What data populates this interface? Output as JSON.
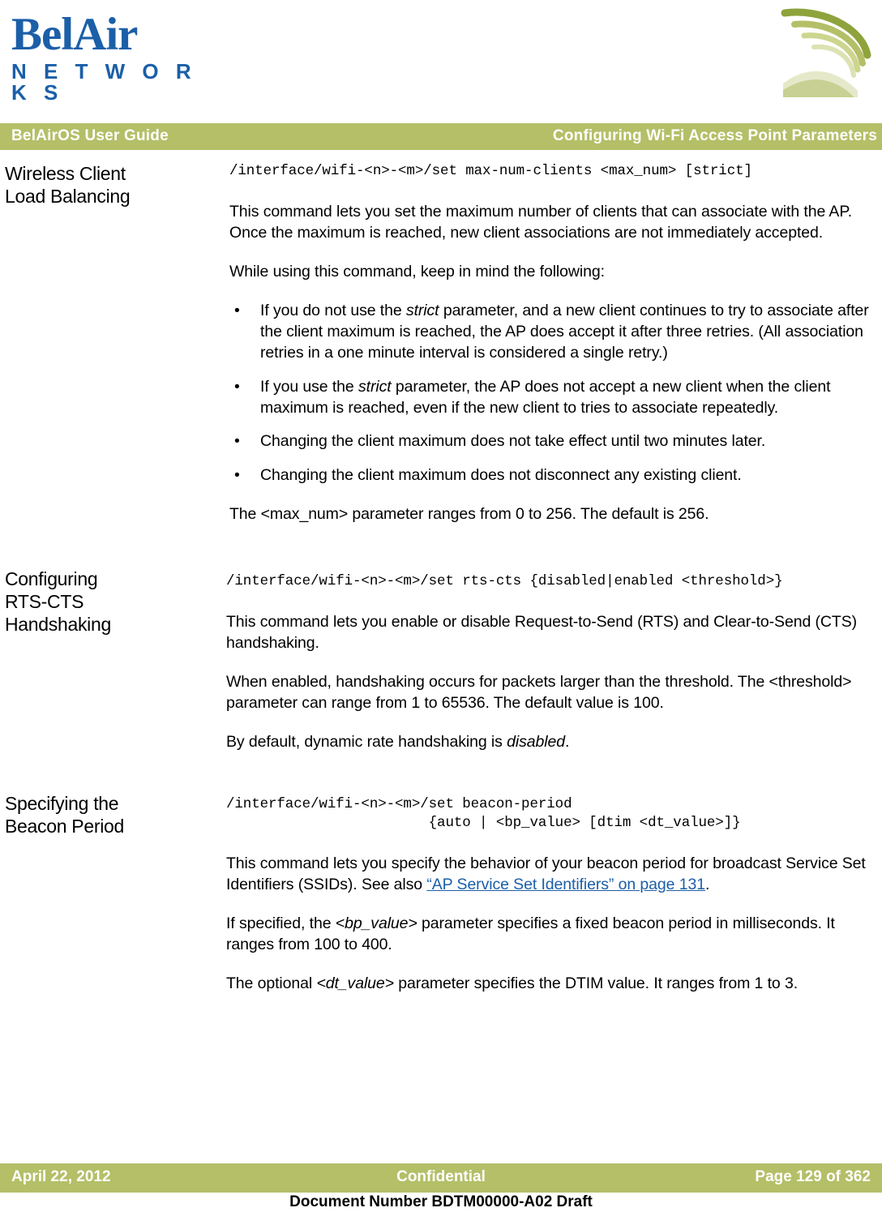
{
  "logo": {
    "brand_top": "BelAir",
    "brand_bottom": "N E T W O R K S",
    "brand_color": "#1b5fa8"
  },
  "header": {
    "left": "BelAirOS User Guide",
    "right": "Configuring Wi-Fi Access Point Parameters",
    "bar_color": "#b4bf68"
  },
  "sections": [
    {
      "heading": "Wireless Client\nLoad Balancing",
      "command": "/interface/wifi-<n>-<m>/set max-num-clients <max_num> [strict]",
      "paragraphs": [
        "This command lets you set the maximum number of clients that can associate with the AP. Once the maximum is reached, new client associations are not immediately accepted.",
        "While using this command, keep in mind the following:"
      ],
      "bullets": [
        "If you do not use the strict parameter, and a new client continues to try to associate after the client maximum is reached, the AP does accept it after three retries. (All association retries in a one minute interval is considered a single retry.)",
        "If you use the strict parameter, the AP does not accept a new client when the client maximum is reached, even if the new client to tries to associate repeatedly.",
        "Changing the client maximum does not take effect until two minutes later.",
        "Changing the client maximum does not disconnect any existing client."
      ],
      "closing": "The <max_num> parameter ranges from 0 to 256. The default is 256."
    },
    {
      "heading": "Configuring\nRTS-CTS\nHandshaking",
      "command": "/interface/wifi-<n>-<m>/set rts-cts {disabled|enabled <threshold>}",
      "paragraphs": [
        "This command lets you enable or disable Request-to-Send (RTS) and Clear-to-Send (CTS) handshaking.",
        "When enabled, handshaking occurs for packets larger than the threshold. The <threshold> parameter can range from 1 to 65536. The default value is 100.",
        "By default, dynamic rate handshaking is disabled."
      ]
    },
    {
      "heading": "Specifying the\nBeacon Period",
      "command": "/interface/wifi-<n>-<m>/set beacon-period\n                       {auto | <bp_value> [dtim <dt_value>]}",
      "paragraphs": [
        "This command lets you specify the behavior of your beacon period for broadcast Service Set Identifiers (SSIDs). See also “AP Service Set Identifiers” on page 131.",
        "If specified, the <bp_value> parameter specifies a fixed beacon period in milliseconds. It ranges from 100 to 400.",
        "The optional <dt_value> parameter specifies the DTIM value. It ranges from 1 to 3."
      ],
      "link_text": "“AP Service Set Identifiers” on page 131"
    }
  ],
  "section1": {
    "heading_line1": "Wireless Client",
    "heading_line2": "Load Balancing",
    "command": "/interface/wifi-<n>-<m>/set max-num-clients <max_num> [strict]",
    "p1": "This command lets you set the maximum number of clients that can associate with the AP. Once the maximum is reached, new client associations are not immediately accepted.",
    "p2": "While using this command, keep in mind the following:",
    "b1_pre": "If you do not use the ",
    "b1_it": "strict",
    "b1_post": " parameter, and a new client continues to try to associate after the client maximum is reached, the AP does accept it after three retries. (All association retries in a one minute interval is considered a single retry.)",
    "b2_pre": "If you use the ",
    "b2_it": "strict",
    "b2_post": " parameter, the AP does not accept a new client when the client maximum is reached, even if the new client to tries to associate repeatedly.",
    "b3": "Changing the client maximum does not take effect until two minutes later.",
    "b4": "Changing the client maximum does not disconnect any existing client.",
    "p3": "The <max_num> parameter ranges from 0 to 256. The default is 256."
  },
  "section2": {
    "heading_line1": "Configuring",
    "heading_line2": "RTS-CTS",
    "heading_line3": "Handshaking",
    "command": "/interface/wifi-<n>-<m>/set rts-cts {disabled|enabled <threshold>}",
    "p1": "This command lets you enable or disable Request-to-Send (RTS) and Clear-to-Send (CTS) handshaking.",
    "p2": "When enabled, handshaking occurs for packets larger than the threshold. The <threshold> parameter can range from 1 to 65536. The default value is 100.",
    "p3_pre": "By default, dynamic rate handshaking is ",
    "p3_it": "disabled",
    "p3_post": "."
  },
  "section3": {
    "heading_line1": "Specifying the",
    "heading_line2": "Beacon Period",
    "command_line1": "/interface/wifi-<n>-<m>/set beacon-period",
    "command_line2": "                        {auto | <bp_value> [dtim <dt_value>]}",
    "p1_pre": "This command lets you specify the behavior of your beacon period for broadcast Service Set Identifiers (SSIDs). See also ",
    "p1_link": "“AP Service Set Identifiers” on page 131",
    "p1_post": ".",
    "p2_pre": "If specified, the ",
    "p2_it": "<bp_value>",
    "p2_post": " parameter specifies a fixed beacon period in milliseconds. It ranges from 100 to 400.",
    "p3_pre": "The optional ",
    "p3_it": "<dt_value>",
    "p3_post": " parameter specifies the DTIM value. It ranges from 1 to 3."
  },
  "bullet_char": "•",
  "footer": {
    "date": "April 22, 2012",
    "center": "Confidential",
    "page": "Page 129 of 362",
    "document_number": "Document Number BDTM00000-A02 Draft"
  }
}
